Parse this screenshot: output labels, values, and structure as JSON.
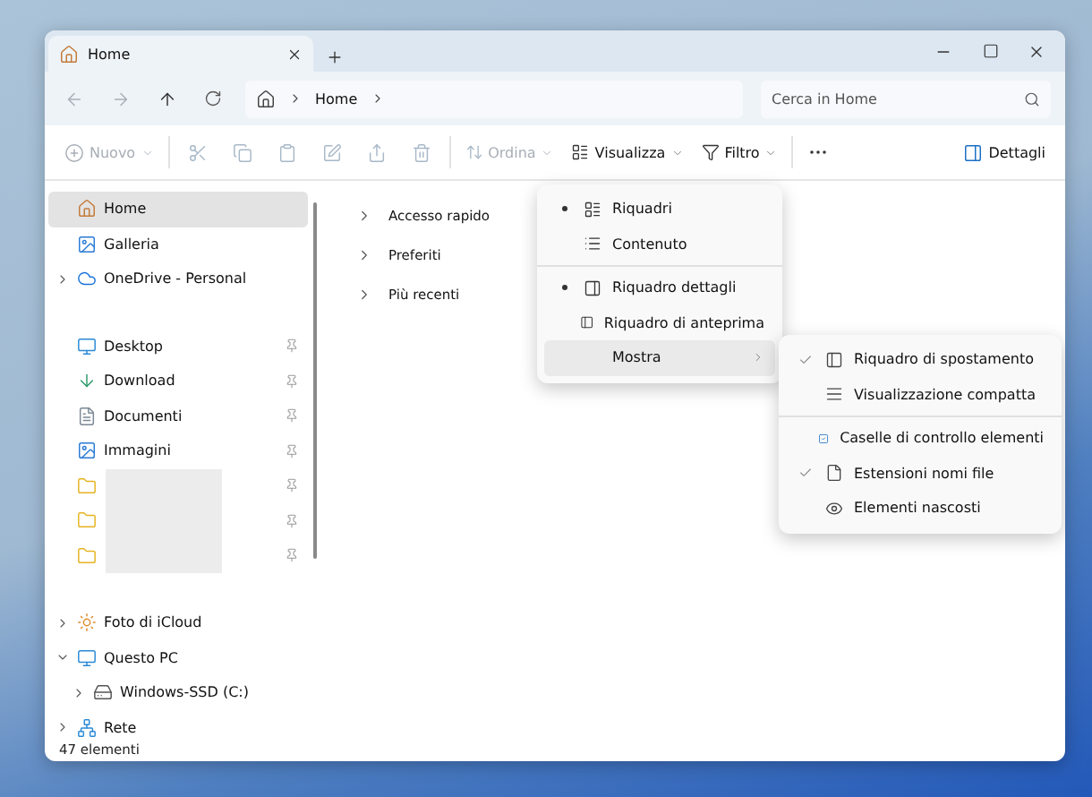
{
  "window": {
    "tabs": [
      {
        "label": "Home",
        "selected": true
      }
    ]
  },
  "nav": {
    "breadcrumb": [
      "Home"
    ],
    "search": {
      "placeholder": "Cerca in Home"
    }
  },
  "toolbar": {
    "new": {
      "label": "Nuovo",
      "disabled": true
    },
    "actions": [
      {
        "disabled": true
      },
      {
        "disabled": true
      },
      {
        "disabled": true
      },
      {
        "disabled": true
      },
      {
        "disabled": true
      },
      {
        "disabled": true
      }
    ],
    "sort": {
      "label": "Ordina",
      "disabled": true
    },
    "view": {
      "label": "Visualizza",
      "disabled": false
    },
    "filter": {
      "label": "Filtro",
      "disabled": false
    },
    "details": {
      "label": "Dettagli"
    }
  },
  "sidebar": {
    "sections": [
      {
        "items": [
          {
            "kind": "home",
            "label": "Home",
            "selected": true
          },
          {
            "kind": "gallery",
            "label": "Galleria",
            "selected": false
          },
          {
            "kind": "cloud",
            "label": "OneDrive - Personal",
            "selected": false,
            "expanded": false
          }
        ]
      },
      {
        "items": [
          {
            "kind": "desktop",
            "label": "Desktop",
            "selected": false,
            "pinned": true
          },
          {
            "kind": "download",
            "label": "Download",
            "selected": false,
            "pinned": true
          },
          {
            "kind": "documents",
            "label": "Documenti",
            "selected": false,
            "pinned": true
          },
          {
            "kind": "pictures",
            "label": "Immagini",
            "selected": false,
            "pinned": true
          }
        ],
        "hidden_items": [
          {
            "kind": "folder",
            "pinned": true
          },
          {
            "kind": "folder",
            "pinned": true
          },
          {
            "kind": "folder",
            "pinned": true
          }
        ]
      },
      {
        "items": [
          {
            "kind": "photos",
            "label": "Foto di iCloud",
            "selected": false,
            "expanded": false
          },
          {
            "kind": "pc",
            "label": "Questo PC",
            "selected": false,
            "expanded": true,
            "children": [
              {
                "kind": "drive",
                "label": "Windows-SSD (C:)",
                "selected": false,
                "expanded": false
              }
            ]
          },
          {
            "kind": "network",
            "label": "Rete",
            "selected": false,
            "expanded": false
          }
        ]
      }
    ]
  },
  "content": {
    "groups": [
      {
        "label": "Accesso rapido",
        "expanded": false
      },
      {
        "label": "Preferiti",
        "expanded": false
      },
      {
        "label": "Più recenti",
        "expanded": false
      }
    ]
  },
  "view_menu": {
    "items": [
      {
        "kind": "option",
        "label": "Riquadri",
        "selected": true
      },
      {
        "kind": "option",
        "label": "Contenuto",
        "selected": false
      },
      {
        "kind": "divider"
      },
      {
        "kind": "option",
        "label": "Riquadro dettagli",
        "selected": true
      },
      {
        "kind": "option",
        "label": "Riquadro di anteprima",
        "selected": false
      },
      {
        "kind": "submenu",
        "label": "Mostra",
        "highlighted": true
      }
    ]
  },
  "show_menu": {
    "items": [
      {
        "label": "Riquadro di spostamento",
        "checked": true
      },
      {
        "label": "Visualizzazione compatta",
        "checked": false
      },
      {
        "label": "Caselle di controllo elementi",
        "checked": false
      },
      {
        "label": "Estensioni nomi file",
        "checked": true
      },
      {
        "label": "Elementi nascosti",
        "checked": false
      }
    ]
  },
  "status_bar": {
    "text": "47 elementi"
  }
}
